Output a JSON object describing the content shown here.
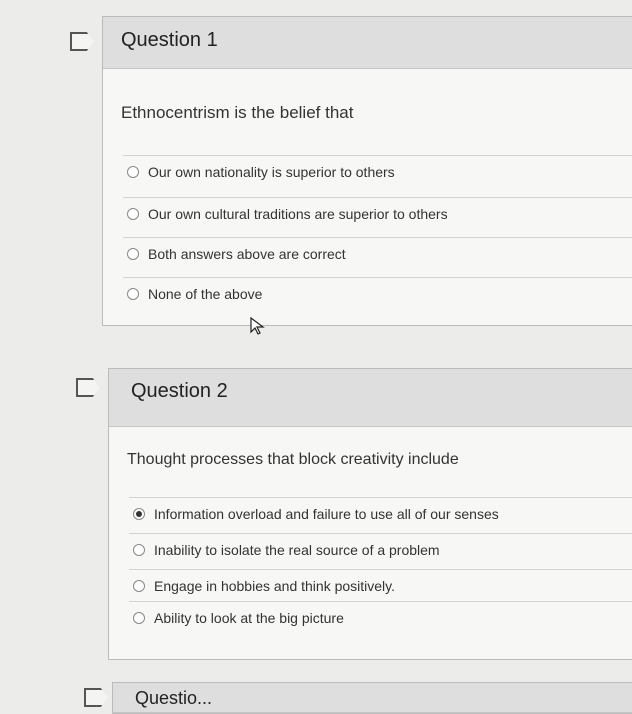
{
  "questions": [
    {
      "title": "Question 1",
      "text": "Ethnocentrism is the belief that",
      "options": [
        "Our own nationality is superior to others",
        "Our own cultural traditions are superior to others",
        "Both answers above are correct",
        "None of the above"
      ],
      "selected": null
    },
    {
      "title": "Question 2",
      "text": "Thought processes that block creativity include",
      "options": [
        "Information overload and failure to use all of our senses",
        "Inability to isolate the real source of a problem",
        "Engage in hobbies and think positively.",
        "Ability to look at the big picture"
      ],
      "selected": 0
    },
    {
      "title": "Questio..."
    }
  ],
  "icons": {
    "flag": "flag-icon",
    "cursor": "mouse-pointer-icon"
  }
}
